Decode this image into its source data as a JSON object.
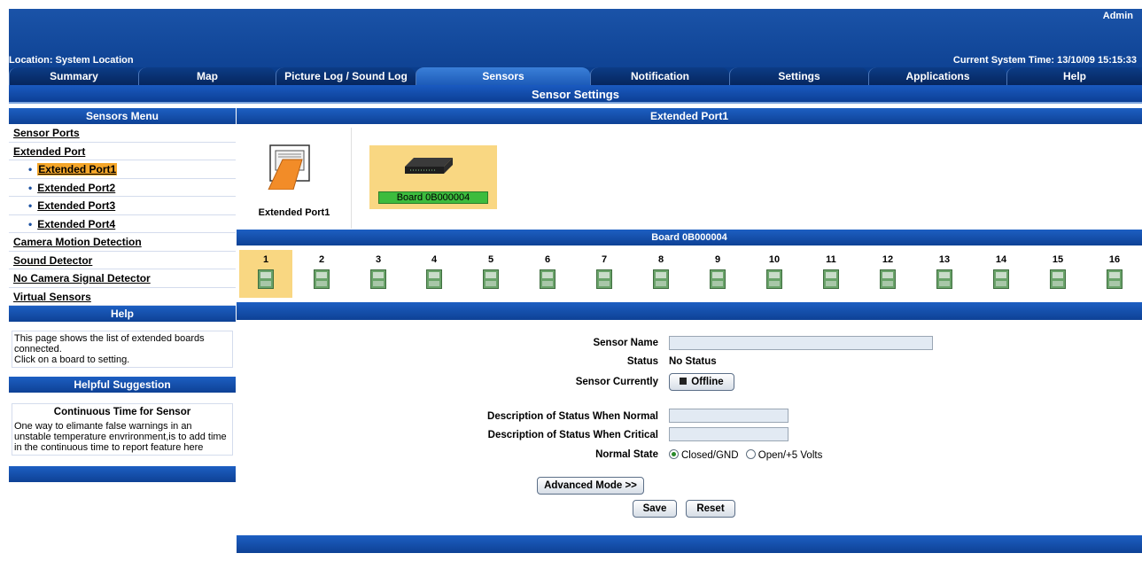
{
  "header": {
    "user": "Admin",
    "location": "Location: System Location",
    "time": "Current System Time: 13/10/09 15:15:33"
  },
  "tabs": [
    {
      "label": "Summary"
    },
    {
      "label": "Map"
    },
    {
      "label": "Picture Log / Sound Log"
    },
    {
      "label": "Sensors",
      "active": true
    },
    {
      "label": "Notification"
    },
    {
      "label": "Settings"
    },
    {
      "label": "Applications"
    },
    {
      "label": "Help"
    }
  ],
  "page_title": "Sensor Settings",
  "sidebar": {
    "menu_title": "Sensors Menu",
    "items": [
      {
        "label": "Sensor Ports"
      },
      {
        "label": "Extended Port"
      },
      {
        "label": "Extended Port1",
        "selected": true
      },
      {
        "label": "Extended Port2"
      },
      {
        "label": "Extended Port3"
      },
      {
        "label": "Extended Port4"
      },
      {
        "label": "Camera Motion Detection"
      },
      {
        "label": "Sound Detector"
      },
      {
        "label": "No Camera Signal Detector"
      },
      {
        "label": "Virtual Sensors"
      }
    ],
    "help_title": "Help",
    "help_line1": "This page shows the list of extended boards connected.",
    "help_line2": "Click on a board to setting.",
    "suggestion_title": "Helpful Suggestion",
    "suggestion_heading": "Continuous Time for Sensor",
    "suggestion_text": "One way to elimante false warnings in an unstable temperature envrironment,is to add time in the continuous time to report feature here"
  },
  "main": {
    "section_title": "Extended Port1",
    "port_label": "Extended Port1",
    "board_label": "Board 0B000004",
    "board_header": "Board 0B000004",
    "slots": [
      "1",
      "2",
      "3",
      "4",
      "5",
      "6",
      "7",
      "8",
      "9",
      "10",
      "11",
      "12",
      "13",
      "14",
      "15",
      "16"
    ],
    "selected_slot": "1"
  },
  "form": {
    "sensor_name_label": "Sensor Name",
    "sensor_name_value": "",
    "status_label": "Status",
    "status_value": "No Status",
    "currently_label": "Sensor Currently",
    "currently_button": "Offline",
    "normal_desc_label": "Description of Status When Normal",
    "normal_desc_value": "",
    "critical_desc_label": "Description of Status When Critical",
    "critical_desc_value": "",
    "normal_state_label": "Normal State",
    "option_closed": "Closed/GND",
    "option_open": "Open/+5 Volts",
    "selected_option": "Closed/GND",
    "advanced_button": "Advanced Mode >>",
    "save_button": "Save",
    "reset_button": "Reset"
  }
}
